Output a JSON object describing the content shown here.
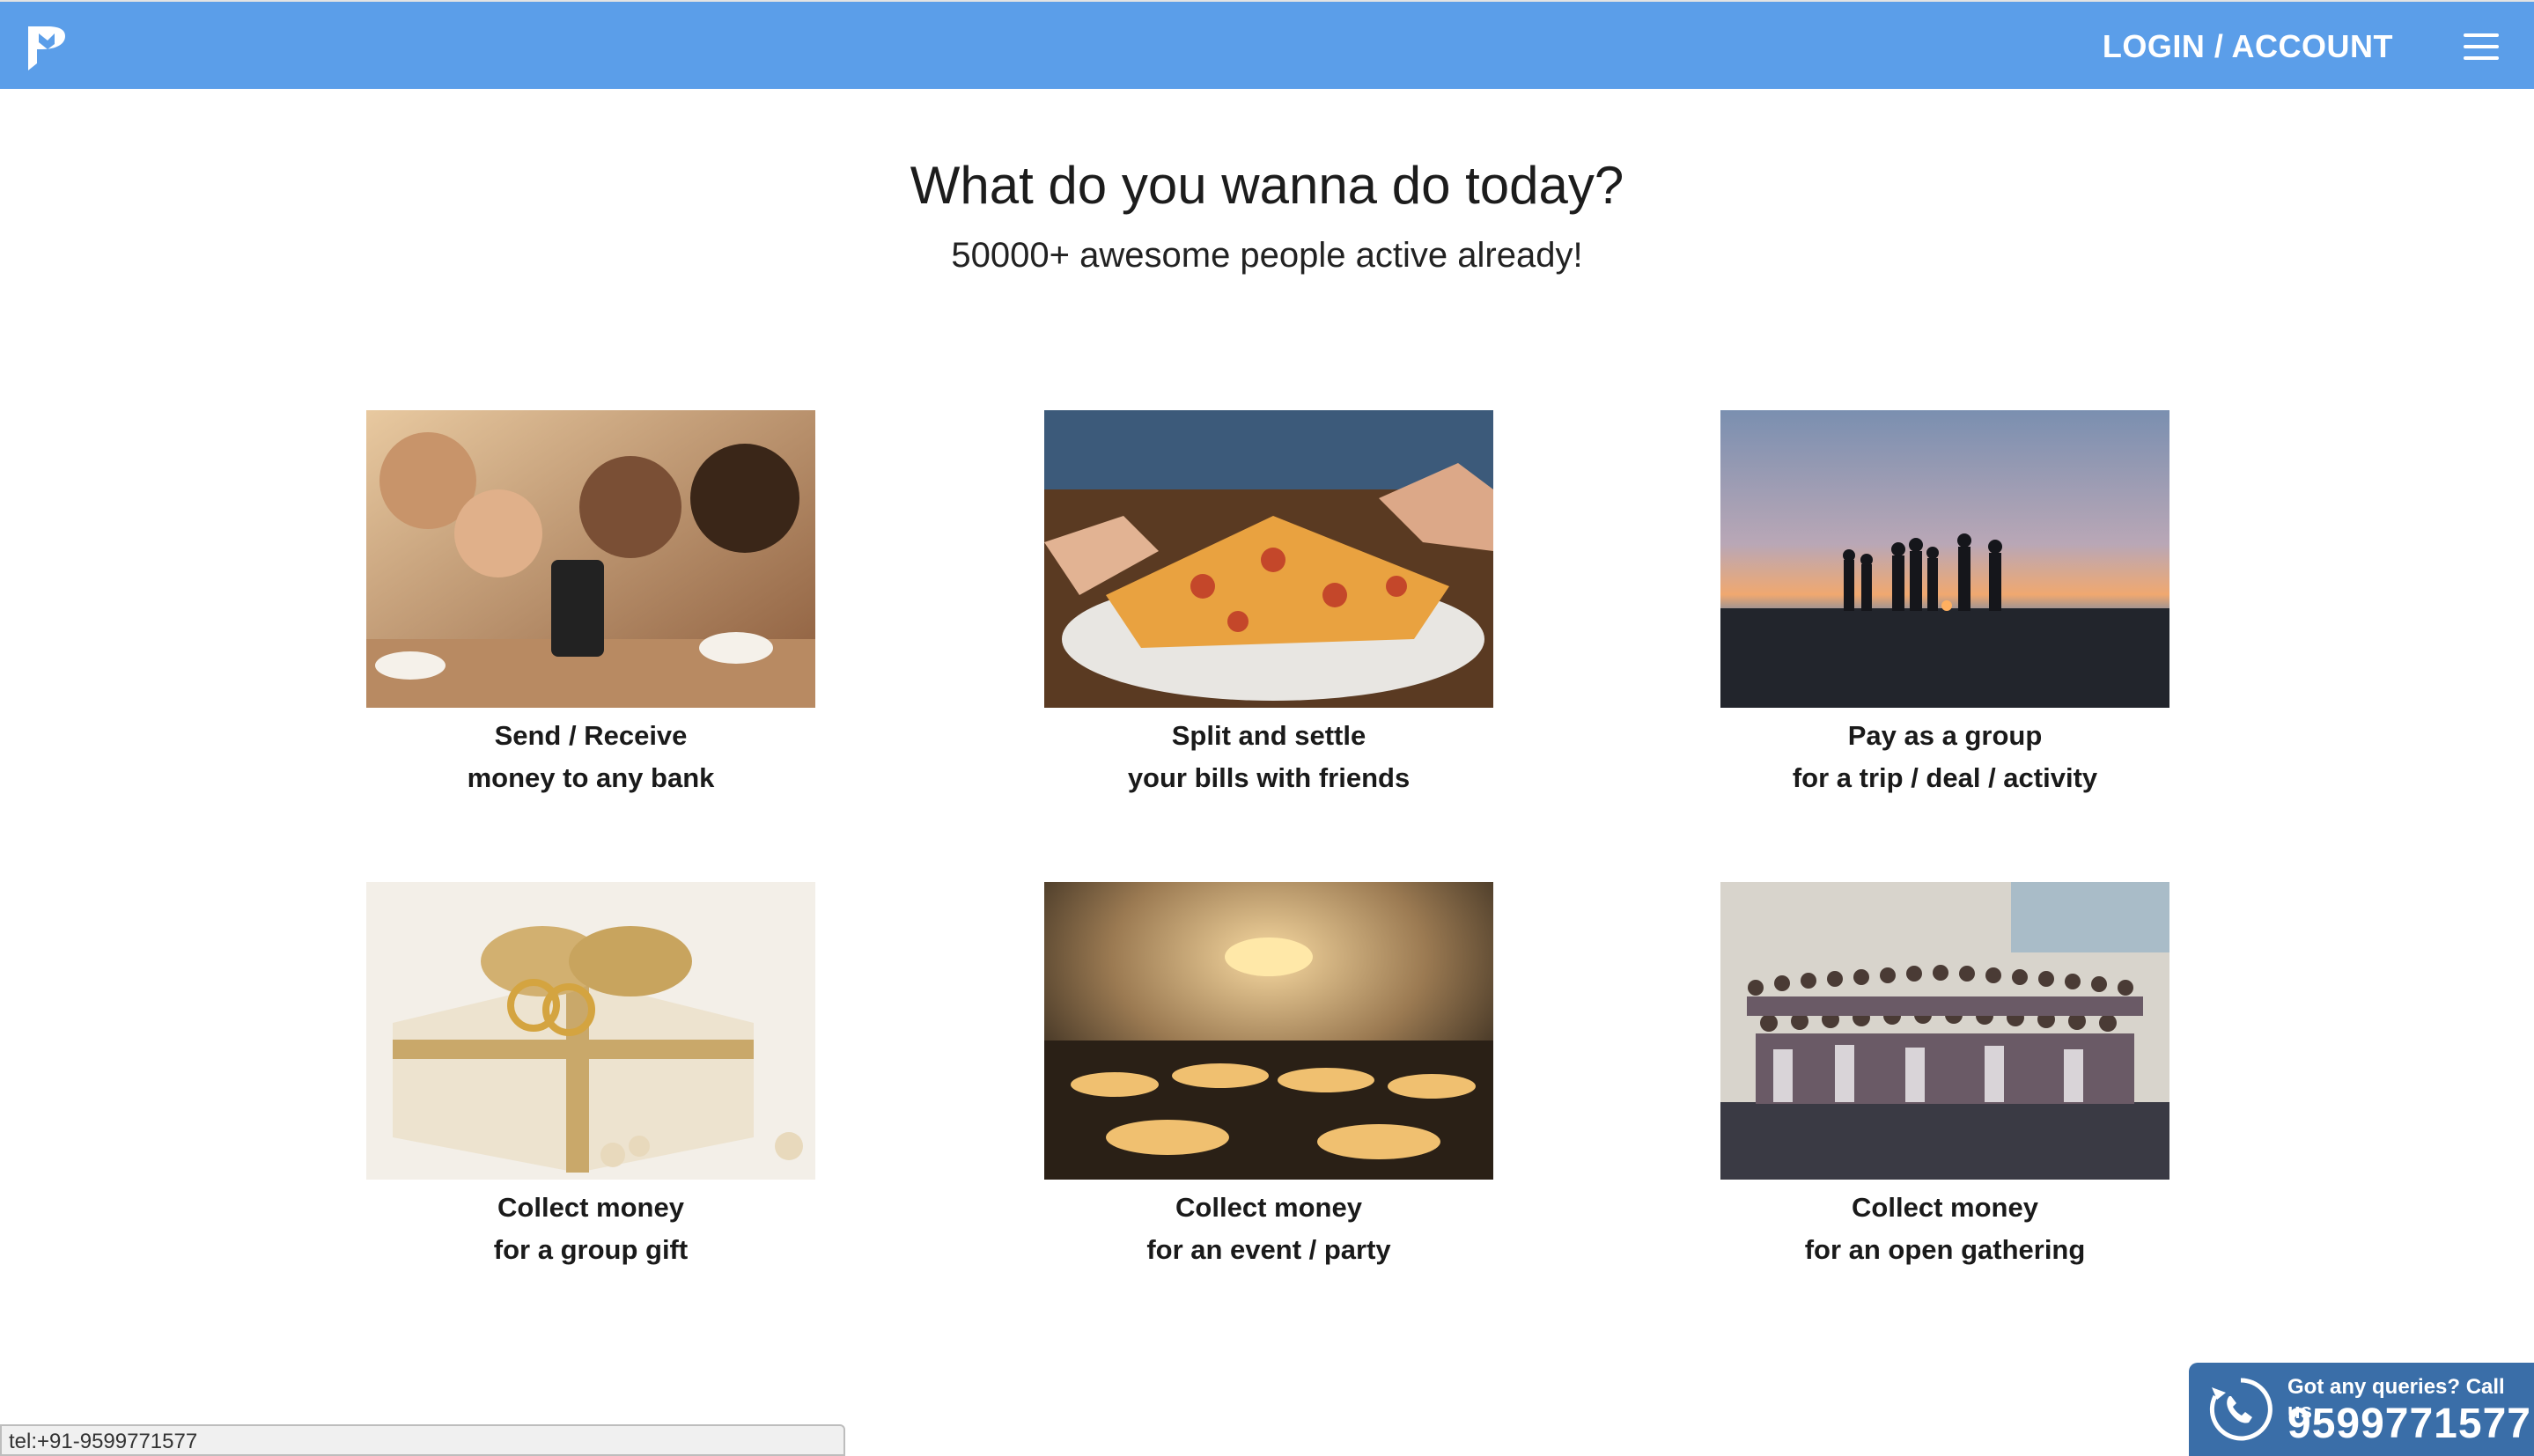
{
  "nav": {
    "login_label": "LOGIN / ACCOUNT",
    "brand_color": "#5b9ee9"
  },
  "hero": {
    "title": "What do you wanna do today?",
    "subtitle": "50000+ awesome people active already!"
  },
  "cards": [
    {
      "line1": "Send / Receive",
      "line2": "money to any bank",
      "image": "friends-with-phone-photo"
    },
    {
      "line1": "Split and settle",
      "line2": "your bills with friends",
      "image": "pizza-sharing-photo"
    },
    {
      "line1": "Pay as a group",
      "line2": "for a trip / deal / activity",
      "image": "beach-sunset-group-photo"
    },
    {
      "line1": "Collect money",
      "line2": "for a group gift",
      "image": "gift-box-rings-photo"
    },
    {
      "line1": "Collect money",
      "line2": "for an event / party",
      "image": "banquet-hall-photo"
    },
    {
      "line1": "Collect money",
      "line2": "for an open gathering",
      "image": "large-group-photo"
    }
  ],
  "status_bar": {
    "url": "tel:+91-9599771577"
  },
  "callus": {
    "question": "Got any queries? Call us",
    "phone": "9599771577",
    "color": "#3a6ea8"
  }
}
